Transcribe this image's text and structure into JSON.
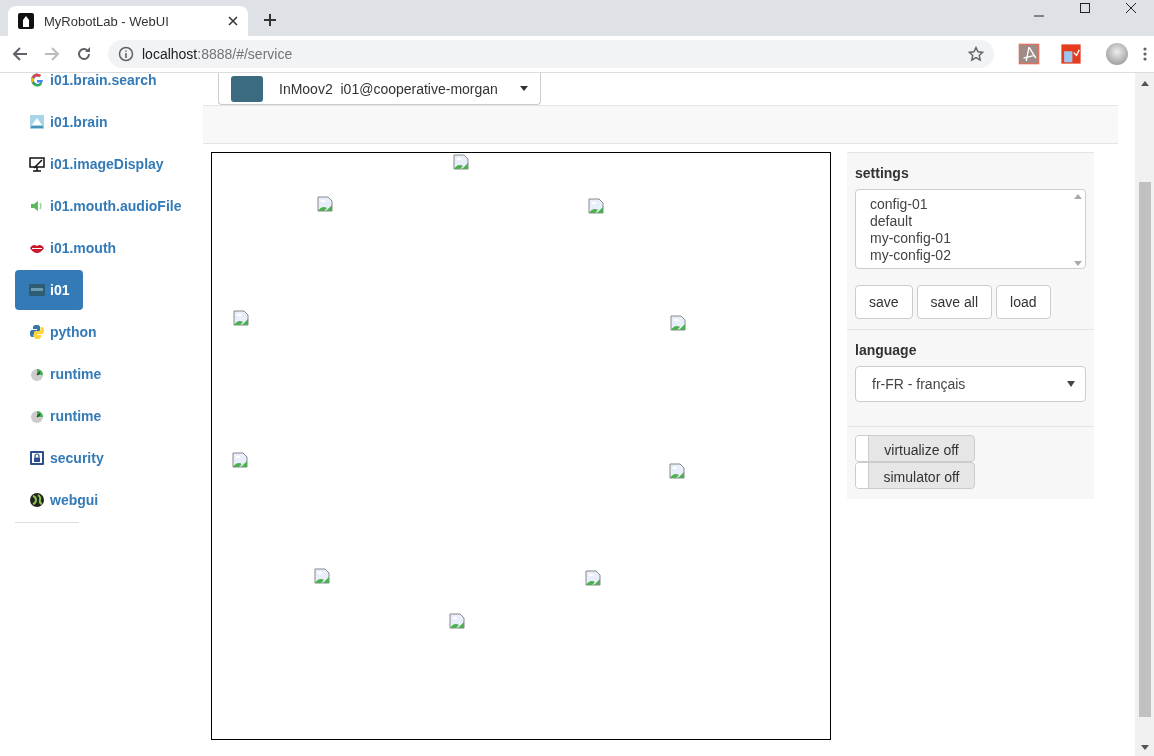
{
  "browser": {
    "tab_title": "MyRobotLab - WebUI",
    "url_host": "localhost",
    "url_path": ":8888/#/service",
    "forward_disabled": true
  },
  "service_selector": {
    "type": "InMoov2",
    "name": "i01@cooperative-morgan"
  },
  "sidebar": {
    "items": [
      {
        "label": "i01.brain.search",
        "kind": "google",
        "selected": false
      },
      {
        "label": "i01.brain",
        "kind": "brain",
        "selected": false
      },
      {
        "label": "i01.imageDisplay",
        "kind": "display",
        "selected": false
      },
      {
        "label": "i01.mouth.audioFile",
        "kind": "audio",
        "selected": false
      },
      {
        "label": "i01.mouth",
        "kind": "mouth",
        "selected": false
      },
      {
        "label": "i01",
        "kind": "inmoov",
        "selected": true
      },
      {
        "label": "python",
        "kind": "python",
        "selected": false
      },
      {
        "label": "runtime",
        "kind": "runtime",
        "selected": false
      },
      {
        "label": "runtime",
        "kind": "runtime",
        "selected": false
      },
      {
        "label": "security",
        "kind": "security",
        "selected": false
      },
      {
        "label": "webgui",
        "kind": "globe",
        "selected": false
      }
    ]
  },
  "canvas": {
    "images": [
      {
        "kind": "broken-image"
      },
      {
        "kind": "broken-image"
      },
      {
        "kind": "broken-image"
      },
      {
        "kind": "broken-image"
      },
      {
        "kind": "broken-image"
      },
      {
        "kind": "broken-image"
      },
      {
        "kind": "broken-image"
      },
      {
        "kind": "broken-image"
      },
      {
        "kind": "broken-image"
      },
      {
        "kind": "broken-image"
      }
    ]
  },
  "settings": {
    "title": "settings",
    "configs": [
      "config-01",
      "default",
      "my-config-01",
      "my-config-02"
    ],
    "buttons": [
      "save",
      "save all",
      "load"
    ]
  },
  "language": {
    "title": "language",
    "value": "fr-FR - français"
  },
  "toggles": [
    {
      "label": "virtualize off",
      "on": false
    },
    {
      "label": "simulator off",
      "on": false
    }
  ]
}
